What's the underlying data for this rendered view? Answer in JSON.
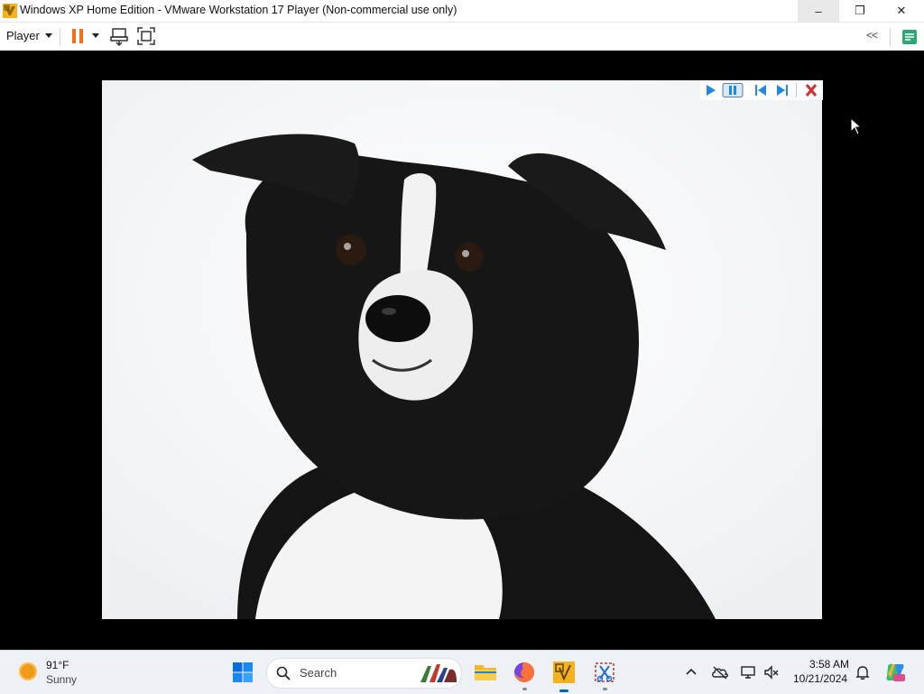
{
  "window": {
    "title": "Windows XP Home Edition - VMware Workstation 17 Player (Non-commercial use only)",
    "minimize_glyph": "–",
    "restore_glyph": "❐",
    "close_glyph": "✕"
  },
  "toolbar": {
    "player_menu_label": "Player",
    "collapse_glyph": "<<",
    "icons": [
      "pause-icon",
      "send-ctrl-alt-del-icon",
      "fit-guest-icon",
      "collapse-icon",
      "notes-icon"
    ]
  },
  "guest": {
    "content": "border-collie-photo",
    "media_controls": [
      "play-icon",
      "pause-icon",
      "previous-icon",
      "next-icon",
      "close-icon"
    ]
  },
  "taskbar": {
    "weather": {
      "temp": "91°F",
      "condition": "Sunny"
    },
    "search_placeholder": "Search",
    "apps": [
      "start-icon",
      "file-explorer-icon",
      "firefox-icon",
      "vmware-icon",
      "snipping-tool-icon"
    ],
    "tray": {
      "icons": [
        "chevron-up-icon",
        "onedrive-icon",
        "network-icon",
        "volume-icon",
        "notification-icon"
      ],
      "time": "3:58 AM",
      "date": "10/21/2024"
    }
  },
  "colors": {
    "vm_pause": "#f37021",
    "accent_blue": "#0067c0",
    "media_button_blue": "#1e88e5",
    "media_close_red": "#d32f2f"
  }
}
